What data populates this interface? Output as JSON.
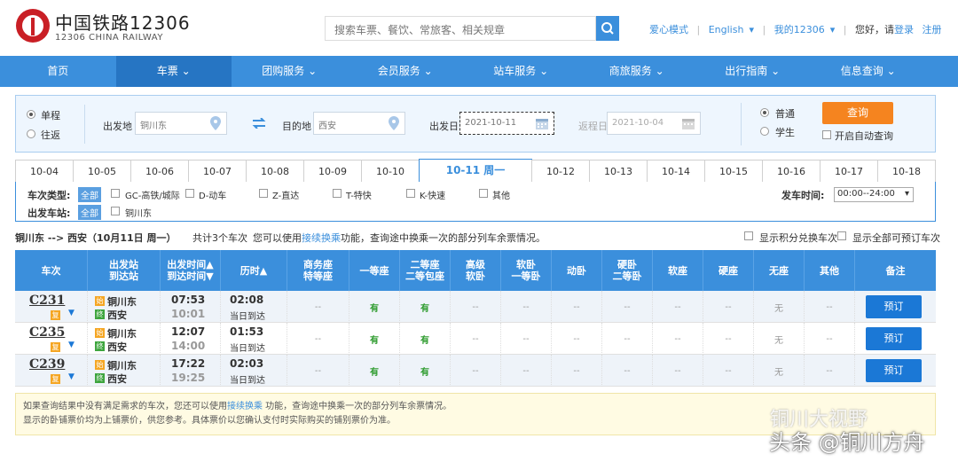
{
  "header": {
    "logo_title": "中国铁路12306",
    "logo_sub": "12306 CHINA RAILWAY",
    "search_placeholder": "搜索车票、餐饮、常旅客、相关规章",
    "links": {
      "care_mode": "爱心模式",
      "english": "English",
      "my12306": "我的12306",
      "greeting": "您好，请",
      "login": "登录",
      "register": "注册"
    }
  },
  "nav": {
    "items": [
      "首页",
      "车票",
      "团购服务",
      "会员服务",
      "站车服务",
      "商旅服务",
      "出行指南",
      "信息查询"
    ]
  },
  "query": {
    "trip_one_way": "单程",
    "trip_round": "往返",
    "from_label": "出发地",
    "from_value": "铜川东",
    "to_label": "目的地",
    "to_value": "西安",
    "depart_label": "出发日",
    "depart_value": "2021-10-11",
    "return_label": "返程日",
    "return_value": "2021-10-04",
    "passenger_normal": "普通",
    "passenger_student": "学生",
    "query_button": "查询",
    "auto_query": "开启自动查询"
  },
  "date_tabs": [
    "10-04",
    "10-05",
    "10-06",
    "10-07",
    "10-08",
    "10-09",
    "10-10",
    "10-11 周一",
    "10-12",
    "10-13",
    "10-14",
    "10-15",
    "10-16",
    "10-17",
    "10-18"
  ],
  "filter": {
    "type_label": "车次类型:",
    "all": "全部",
    "types": [
      "GC-高铁/城际",
      "D-动车",
      "Z-直达",
      "T-特快",
      "K-快速",
      "其他"
    ],
    "station_label": "出发车站:",
    "stations": [
      "铜川东"
    ],
    "time_label": "发车时间:",
    "time_value": "00:00--24:00"
  },
  "summary": {
    "route": "铜川东 --> 西安（10月11日 周一）",
    "count": "共计3个车次",
    "hint_pre": "您可以使用",
    "hint_link": "接续换乘",
    "hint_post": "功能，查询途中换乘一次的部分列车余票情况。",
    "show_points": "显示积分兑换车次",
    "show_all": "显示全部可预订车次"
  },
  "table": {
    "headers": [
      "车次",
      "出发站\n到达站",
      "出发时间▲\n到达时间▼",
      "历时▲",
      "商务座\n特等座",
      "一等座",
      "二等座\n二等包座",
      "高级\n软卧",
      "软卧\n一等卧",
      "动卧",
      "硬卧\n二等卧",
      "软座",
      "硬座",
      "无座",
      "其他",
      "备注"
    ],
    "start_icon": "始",
    "end_icon": "终",
    "tag": "复",
    "rows": [
      {
        "train": "C231",
        "from": "铜川东",
        "to": "西安",
        "dep": "07:53",
        "arr": "10:01",
        "dur": "02:08",
        "day": "当日到达",
        "seats": [
          "--",
          "有",
          "有",
          "--",
          "--",
          "--",
          "--",
          "--",
          "--",
          "无",
          "--"
        ],
        "book": "预订"
      },
      {
        "train": "C235",
        "from": "铜川东",
        "to": "西安",
        "dep": "12:07",
        "arr": "14:00",
        "dur": "01:53",
        "day": "当日到达",
        "seats": [
          "--",
          "有",
          "有",
          "--",
          "--",
          "--",
          "--",
          "--",
          "--",
          "无",
          "--"
        ],
        "book": "预订"
      },
      {
        "train": "C239",
        "from": "铜川东",
        "to": "西安",
        "dep": "17:22",
        "arr": "19:25",
        "dur": "02:03",
        "day": "当日到达",
        "seats": [
          "--",
          "有",
          "有",
          "--",
          "--",
          "--",
          "--",
          "--",
          "--",
          "无",
          "--"
        ],
        "book": "预订"
      }
    ]
  },
  "notice": {
    "line1_pre": "如果查询结果中没有满足需求的车次，您还可以使用",
    "line1_link": "接续换乘",
    "line1_post": " 功能，查询途中换乘一次的部分列车余票情况。",
    "line2": "显示的卧铺票价均为上铺票价，供您参考。具体票价以您确认支付时实际购买的铺别票价为准。"
  },
  "watermark": {
    "line1": "铜川大视野",
    "line2": "头条 @铜川方舟"
  },
  "colors": {
    "brand_red": "#c91f25",
    "nav_blue": "#3b8fdc",
    "button_orange": "#f5841f",
    "available_green": "#2d9b2d"
  }
}
